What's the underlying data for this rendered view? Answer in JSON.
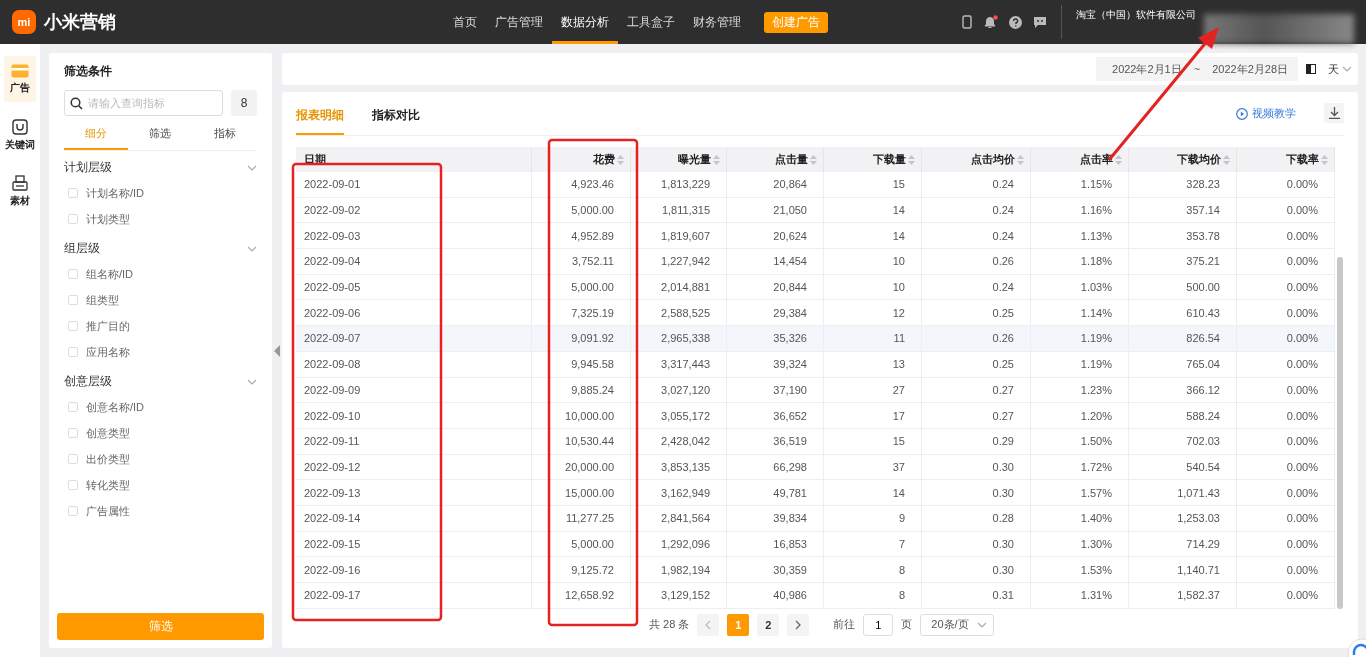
{
  "topbar": {
    "logo_mark": "mi",
    "brand": "小米营销",
    "nav": [
      {
        "label": "首页",
        "selected": false
      },
      {
        "label": "广告管理",
        "selected": false
      },
      {
        "label": "数据分析",
        "selected": true
      },
      {
        "label": "工具盒子",
        "selected": false
      },
      {
        "label": "财务管理",
        "selected": false
      }
    ],
    "create_button": "创建广告",
    "notification_dot": true,
    "company": "淘宝（中国）软件有限公司"
  },
  "rail": [
    {
      "kind": "card",
      "label": "广告",
      "selected": true
    },
    {
      "kind": "bag",
      "label": "关键词",
      "selected": false
    },
    {
      "kind": "printer",
      "label": "素材",
      "selected": false
    }
  ],
  "filter": {
    "title": "筛选条件",
    "search": {
      "placeholder": "请输入查询指标"
    },
    "count": "8",
    "tabs": [
      {
        "label": "细分",
        "selected": true
      },
      {
        "label": "筛选",
        "selected": false
      },
      {
        "label": "指标",
        "selected": false
      }
    ],
    "groups": [
      {
        "title": "计划层级",
        "expanded": true,
        "items": [
          {
            "label": "计划名称/ID",
            "checked": false
          },
          {
            "label": "计划类型",
            "checked": false
          }
        ]
      },
      {
        "title": "组层级",
        "expanded": true,
        "items": [
          {
            "label": "组名称/ID",
            "checked": false
          },
          {
            "label": "组类型",
            "checked": false
          },
          {
            "label": "推广目的",
            "checked": false
          },
          {
            "label": "应用名称",
            "checked": false
          }
        ]
      },
      {
        "title": "创意层级",
        "expanded": true,
        "items": [
          {
            "label": "创意名称/ID",
            "checked": false
          },
          {
            "label": "创意类型",
            "checked": false
          },
          {
            "label": "出价类型",
            "checked": false
          },
          {
            "label": "转化类型",
            "checked": false
          },
          {
            "label": "广告属性",
            "checked": false
          }
        ]
      }
    ],
    "button": "筛选"
  },
  "date_bar": {
    "start": "2022年2月1日",
    "separator": "~",
    "end": "2022年2月28日",
    "granularity": "天"
  },
  "report": {
    "tabs": [
      {
        "label": "报表明细",
        "selected": true
      },
      {
        "label": "指标对比",
        "selected": false
      }
    ],
    "video_link": "视频教学",
    "columns": [
      "日期",
      "花费",
      "曝光量",
      "点击量",
      "下载量",
      "点击均价",
      "点击率",
      "下载均价",
      "下载率"
    ],
    "rows": [
      {
        "hovered": false,
        "cells": [
          "2022-09-01",
          "4,923.46",
          "1,813,229",
          "20,864",
          "15",
          "0.24",
          "1.15%",
          "328.23",
          "0.00%"
        ]
      },
      {
        "hovered": false,
        "cells": [
          "2022-09-02",
          "5,000.00",
          "1,811,315",
          "21,050",
          "14",
          "0.24",
          "1.16%",
          "357.14",
          "0.00%"
        ]
      },
      {
        "hovered": false,
        "cells": [
          "2022-09-03",
          "4,952.89",
          "1,819,607",
          "20,624",
          "14",
          "0.24",
          "1.13%",
          "353.78",
          "0.00%"
        ]
      },
      {
        "hovered": false,
        "cells": [
          "2022-09-04",
          "3,752.11",
          "1,227,942",
          "14,454",
          "10",
          "0.26",
          "1.18%",
          "375.21",
          "0.00%"
        ]
      },
      {
        "hovered": false,
        "cells": [
          "2022-09-05",
          "5,000.00",
          "2,014,881",
          "20,844",
          "10",
          "0.24",
          "1.03%",
          "500.00",
          "0.00%"
        ]
      },
      {
        "hovered": false,
        "cells": [
          "2022-09-06",
          "7,325.19",
          "2,588,525",
          "29,384",
          "12",
          "0.25",
          "1.14%",
          "610.43",
          "0.00%"
        ]
      },
      {
        "hovered": true,
        "cells": [
          "2022-09-07",
          "9,091.92",
          "2,965,338",
          "35,326",
          "11",
          "0.26",
          "1.19%",
          "826.54",
          "0.00%"
        ]
      },
      {
        "hovered": false,
        "cells": [
          "2022-09-08",
          "9,945.58",
          "3,317,443",
          "39,324",
          "13",
          "0.25",
          "1.19%",
          "765.04",
          "0.00%"
        ]
      },
      {
        "hovered": false,
        "cells": [
          "2022-09-09",
          "9,885.24",
          "3,027,120",
          "37,190",
          "27",
          "0.27",
          "1.23%",
          "366.12",
          "0.00%"
        ]
      },
      {
        "hovered": false,
        "cells": [
          "2022-09-10",
          "10,000.00",
          "3,055,172",
          "36,652",
          "17",
          "0.27",
          "1.20%",
          "588.24",
          "0.00%"
        ]
      },
      {
        "hovered": false,
        "cells": [
          "2022-09-11",
          "10,530.44",
          "2,428,042",
          "36,519",
          "15",
          "0.29",
          "1.50%",
          "702.03",
          "0.00%"
        ]
      },
      {
        "hovered": false,
        "cells": [
          "2022-09-12",
          "20,000.00",
          "3,853,135",
          "66,298",
          "37",
          "0.30",
          "1.72%",
          "540.54",
          "0.00%"
        ]
      },
      {
        "hovered": false,
        "cells": [
          "2022-09-13",
          "15,000.00",
          "3,162,949",
          "49,781",
          "14",
          "0.30",
          "1.57%",
          "1,071.43",
          "0.00%"
        ]
      },
      {
        "hovered": false,
        "cells": [
          "2022-09-14",
          "11,277.25",
          "2,841,564",
          "39,834",
          "9",
          "0.28",
          "1.40%",
          "1,253.03",
          "0.00%"
        ]
      },
      {
        "hovered": false,
        "cells": [
          "2022-09-15",
          "5,000.00",
          "1,292,096",
          "16,853",
          "7",
          "0.30",
          "1.30%",
          "714.29",
          "0.00%"
        ]
      },
      {
        "hovered": false,
        "cells": [
          "2022-09-16",
          "9,125.72",
          "1,982,194",
          "30,359",
          "8",
          "0.30",
          "1.53%",
          "1,140.71",
          "0.00%"
        ]
      },
      {
        "hovered": false,
        "cells": [
          "2022-09-17",
          "12,658.92",
          "3,129,152",
          "40,986",
          "8",
          "0.31",
          "1.31%",
          "1,582.37",
          "0.00%"
        ]
      }
    ],
    "pagination": {
      "total": "共 28 条",
      "pages": [
        {
          "label": "1",
          "selected": true
        },
        {
          "label": "2",
          "selected": false
        }
      ],
      "goto_label": "前往",
      "goto_value": "1",
      "page_unit": "页",
      "page_size": "20条/页"
    }
  },
  "annotations": [
    {
      "kind": "frame"
    },
    {
      "kind": "frame"
    },
    {
      "kind": "arrow"
    }
  ]
}
